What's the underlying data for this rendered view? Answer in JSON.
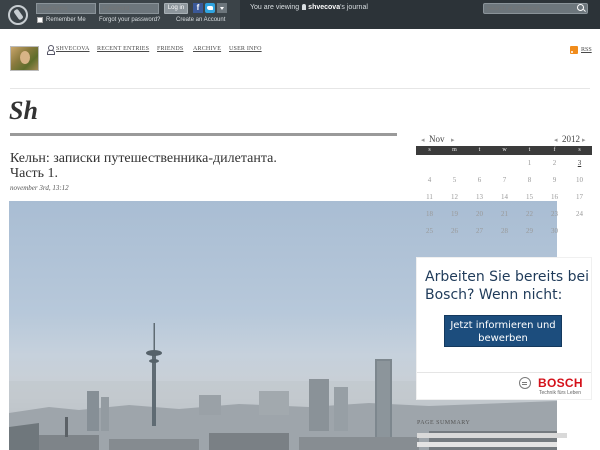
{
  "top_bar": {
    "username_placeholder": "Username",
    "password_placeholder": "Password",
    "login_label": "Log in",
    "remember_label": "Remember Me",
    "forgot_label": "Forgot your password?",
    "create_label": "Create an Account",
    "viewing_prefix": "You are viewing",
    "viewing_user": "shvecova",
    "viewing_suffix": "'s journal",
    "search_placeholder": "Search at shvecova"
  },
  "nav": {
    "user": "SHVECOVA",
    "recent": "RECENT ENTRIES",
    "friends": "FRIENDS",
    "archive": "ARCHIVE",
    "userinfo": "USER INFO",
    "rss": "RSS"
  },
  "journal": {
    "title": "Sh"
  },
  "entry": {
    "title_line1": "Кельн: записки путешественника-дилетанта.",
    "title_line2": "Часть 1.",
    "date": "november 3rd, 13:12"
  },
  "calendar": {
    "month": "Nov",
    "year": "2012",
    "weekdays": [
      "s",
      "m",
      "t",
      "w",
      "t",
      "f",
      "s"
    ],
    "weeks": [
      [
        "",
        "",
        "",
        "",
        "1",
        "2",
        "3"
      ],
      [
        "4",
        "5",
        "6",
        "7",
        "8",
        "9",
        "10"
      ],
      [
        "11",
        "12",
        "13",
        "14",
        "15",
        "16",
        "17"
      ],
      [
        "18",
        "19",
        "20",
        "21",
        "22",
        "23",
        "24"
      ],
      [
        "25",
        "26",
        "27",
        "28",
        "29",
        "30",
        ""
      ]
    ],
    "days_with_entries": [
      "3"
    ]
  },
  "ad": {
    "headline": "Arbeiten Sie bereits bei Bosch? Wenn nicht:",
    "button": "Jetzt informieren und bewerben",
    "brand": "BOSCH",
    "tagline": "Technik fürs Leben"
  },
  "sidebar": {
    "page_summary": "PAGE SUMMARY"
  },
  "colors": {
    "top_bar": "#2c3338",
    "ad_button": "#1c4d7d",
    "bosch_red": "#d4111a",
    "rss_orange": "#f08c1c"
  },
  "icons": [
    "lj-logo-icon",
    "facebook-icon",
    "twitter-icon",
    "chevron-down-icon",
    "search-icon",
    "user-icon",
    "rss-icon",
    "bosch-logo-icon"
  ]
}
